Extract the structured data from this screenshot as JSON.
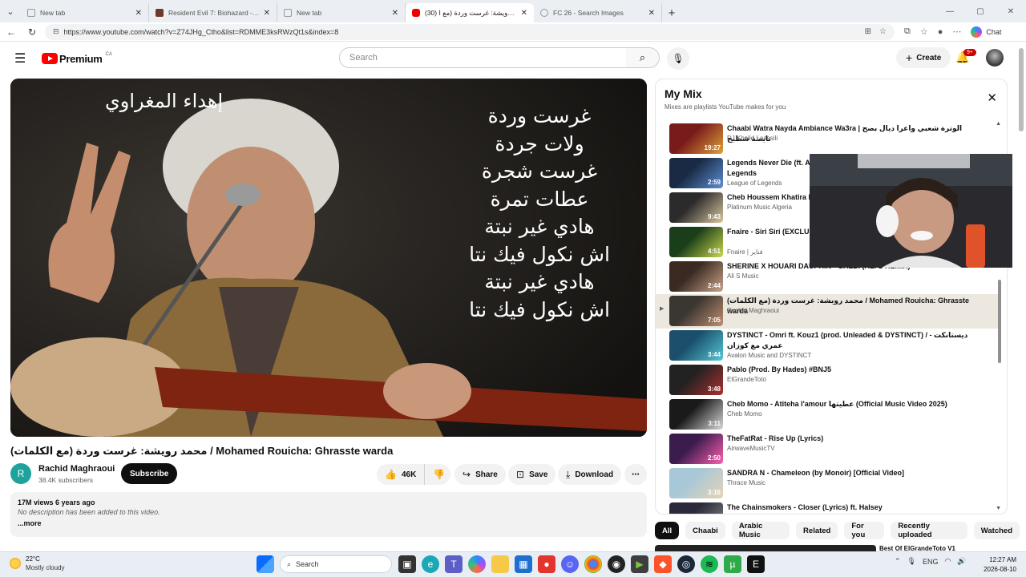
{
  "browser": {
    "tabs": [
      {
        "title": "New tab",
        "active": false
      },
      {
        "title": "Resident Evil 7: Biohazard - Gold E",
        "active": false
      },
      {
        "title": "New tab",
        "active": false
      },
      {
        "title": "(30) محمد رويشة: غرست وردة (مع ا",
        "active": true
      },
      {
        "title": "FC 26 - Search Images",
        "active": false
      }
    ],
    "url": "https://www.youtube.com/watch?v=Z74JHg_Ctho&list=RDMME3ksRWzQt1s&index=8",
    "chat_label": "Chat"
  },
  "header": {
    "logo_text": "Premium",
    "country": "CA",
    "search_placeholder": "Search",
    "create_label": "Create",
    "notif_count": "9+"
  },
  "video": {
    "dedication": "إهداء المغراوي",
    "lyrics": [
      "غرست وردة",
      "ولات جردة",
      "غرست شجرة",
      "عطات تمرة",
      "هادي غير نبتة",
      "اش نكول فيك نتا",
      "هادي غير نبتة",
      "اش نكول فيك نتا"
    ],
    "title": "محمد رويشة: غرست وردة (مع الكلمات) / Mohamed Rouicha: Ghrasste warda",
    "channel_initial": "R",
    "channel": "Rachid Maghraoui",
    "subscribers": "38.4K subscribers",
    "subscribe_label": "Subscribe",
    "likes": "46K",
    "share_label": "Share",
    "save_label": "Save",
    "download_label": "Download",
    "views_meta": "17M views  6 years ago",
    "description": "No description has been added to this video.",
    "more_label": "...more"
  },
  "mix": {
    "title": "My Mix",
    "subtitle": "Mixes are playlists YouTube makes for you",
    "items": [
      {
        "title": "Chaabi Watra Nayda Ambiance Wa3ra | الوترة شعبي واعرا ديال بصح نايضة شطيح",
        "channel": "DJ Khalid Laassili",
        "duration": "19:27",
        "two": false
      },
      {
        "title": "Legends Never Die (ft. Against The Current) | Worlds 2017 - League of Legends",
        "channel": "League of Legends",
        "duration": "2:59",
        "two": true
      },
      {
        "title": "Cheb Houssem Khatira Khatira (Official Audio)",
        "channel": "Platinum Music Algeria",
        "duration": "9:43",
        "two": false
      },
      {
        "title": "Fnaire - Siri Siri (EXCLUSIVE) | فناير - سيري سيري حصري",
        "channel": "Fnaire | فناير",
        "duration": "4:51",
        "two": true
      },
      {
        "title": "SHERINE X HOUARI DAUPHIN - GALBI (ALI S REMIX)",
        "channel": "Ali S Music",
        "duration": "2:44",
        "two": false
      },
      {
        "title": "محمد رويشة: غرست وردة (مع الكلمات) / Mohamed Rouicha: Ghrasste warda",
        "channel": "Rachid Maghraoui",
        "duration": "7:05",
        "two": false
      },
      {
        "title": "DYSTINCT - Omri ft. Kouz1 (prod. Unleaded & DYSTINCT) / ديستانكت - عمري مع كوزان",
        "channel": "Avalon Music and DYSTINCT",
        "duration": "3:44",
        "two": true
      },
      {
        "title": "Pablo (Prod. By Hades) #BNJ5",
        "channel": "ElGrandeToto",
        "duration": "3:48",
        "two": false
      },
      {
        "title": "Cheb Momo - Atiteha l'amour عطيتها (Official Music Video 2025)",
        "channel": "Cheb Momo",
        "duration": "3:11",
        "two": false
      },
      {
        "title": "TheFatRat - Rise Up (Lyrics)",
        "channel": "AirwaveMusicTV",
        "duration": "2:50",
        "two": false
      },
      {
        "title": "SANDRA N - Chameleon (by Monoir) [Official Video]",
        "channel": "Thrace Music",
        "duration": "3:16",
        "two": false
      },
      {
        "title": "The Chainsmokers - Closer (Lyrics) ft. Halsey",
        "channel": "",
        "duration": "",
        "two": false
      }
    ]
  },
  "chips": [
    "All",
    "Chaabi",
    "Arabic Music",
    "Related",
    "For you",
    "Recently uploaded",
    "Watched"
  ],
  "next_rec_title": "Best Of ElGrandeToto V1",
  "taskbar": {
    "temp": "22°C",
    "condition": "Mostly cloudy",
    "search": "Search",
    "lang": "ENG",
    "time": "12:27 AM",
    "date": "2026-08-10"
  },
  "colors": {
    "yt_red": "#ff0000",
    "current_row": "#ece8df",
    "subscribe_bg": "#0f0f0f"
  }
}
